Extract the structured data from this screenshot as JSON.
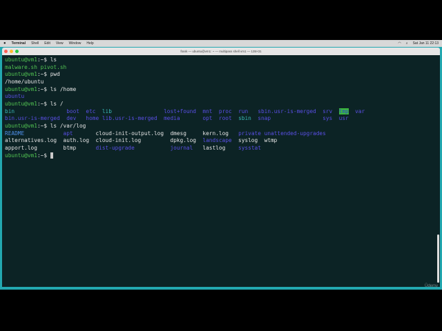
{
  "menubar": {
    "app": "Terminal",
    "items": [
      "Shell",
      "Edit",
      "View",
      "Window",
      "Help"
    ],
    "clock": "Sat Jan 11  22:13"
  },
  "window": {
    "title": "frank — ubuntu@vm1: ~ — multipass shell vm1 — 135×31"
  },
  "watermark": "Ûdemy",
  "colors": {
    "prompt": "#52c452",
    "directory": "#5a4fe6",
    "link": "#3bb8b8",
    "terminal_bg": "#0c2325"
  },
  "terminal": {
    "prompt_user": "ubuntu@vm1",
    "prompt_rest": ":~$ ",
    "lines": [
      {
        "cmd": "ls"
      },
      {
        "out": [
          [
            {
              "t": "malware.sh",
              "c": "g"
            },
            {
              "t": "pivot.sh",
              "c": "g"
            }
          ]
        ],
        "cols": [
          0,
          11
        ]
      },
      {
        "cmd": "pwd"
      },
      {
        "out": [
          [
            {
              "t": "/home/ubuntu",
              "c": "w"
            }
          ]
        ],
        "cols": [
          0
        ]
      },
      {
        "cmd": "ls /home"
      },
      {
        "out": [
          [
            {
              "t": "ubuntu",
              "c": "d"
            }
          ]
        ],
        "cols": [
          0
        ]
      },
      {
        "cmd": "ls /"
      },
      {
        "out": [
          [
            {
              "t": "bin",
              "c": "c"
            },
            {
              "t": "boot",
              "c": "d"
            },
            {
              "t": "etc",
              "c": "d"
            },
            {
              "t": "lib",
              "c": "c"
            },
            {
              "t": "lost+found",
              "c": "d"
            },
            {
              "t": "mnt",
              "c": "d"
            },
            {
              "t": "proc",
              "c": "d"
            },
            {
              "t": "run",
              "c": "d"
            },
            {
              "t": "sbin.usr-is-merged",
              "c": "d"
            },
            {
              "t": "srv",
              "c": "d"
            },
            {
              "t": "tmp",
              "c": "hl"
            },
            {
              "t": "var",
              "c": "d"
            }
          ],
          [
            {
              "t": "bin.usr-is-merged",
              "c": "d"
            },
            {
              "t": "dev",
              "c": "d"
            },
            {
              "t": "home",
              "c": "d"
            },
            {
              "t": "lib.usr-is-merged",
              "c": "d"
            },
            {
              "t": "media",
              "c": "d"
            },
            {
              "t": "opt",
              "c": "d"
            },
            {
              "t": "root",
              "c": "d"
            },
            {
              "t": "sbin",
              "c": "c"
            },
            {
              "t": "snap",
              "c": "d"
            },
            {
              "t": "sys",
              "c": "d"
            },
            {
              "t": "usr",
              "c": "d"
            }
          ]
        ],
        "cols": [
          0,
          19,
          25,
          30,
          49,
          61,
          66,
          72,
          78,
          98,
          103,
          108
        ]
      },
      {
        "cmd": "ls /var/log"
      },
      {
        "out": [
          [
            {
              "t": "README",
              "c": "r"
            },
            {
              "t": "apt",
              "c": "d"
            },
            {
              "t": "cloud-init-output.log",
              "c": "w"
            },
            {
              "t": "dmesg",
              "c": "w"
            },
            {
              "t": "kern.log",
              "c": "w"
            },
            {
              "t": "private",
              "c": "d"
            },
            {
              "t": "unattended-upgrades",
              "c": "d"
            }
          ],
          [
            {
              "t": "alternatives.log",
              "c": "w"
            },
            {
              "t": "auth.log",
              "c": "w"
            },
            {
              "t": "cloud-init.log",
              "c": "w"
            },
            {
              "t": "dpkg.log",
              "c": "w"
            },
            {
              "t": "landscape",
              "c": "d"
            },
            {
              "t": "syslog",
              "c": "w"
            },
            {
              "t": "wtmp",
              "c": "w"
            }
          ],
          [
            {
              "t": "apport.log",
              "c": "w"
            },
            {
              "t": "btmp",
              "c": "w"
            },
            {
              "t": "dist-upgrade",
              "c": "d"
            },
            {
              "t": "journal",
              "c": "d"
            },
            {
              "t": "lastlog",
              "c": "w"
            },
            {
              "t": "sysstat",
              "c": "d"
            }
          ]
        ],
        "cols": [
          0,
          18,
          28,
          51,
          61,
          72,
          80
        ]
      },
      {
        "cmd": "",
        "cursor": true
      }
    ]
  }
}
